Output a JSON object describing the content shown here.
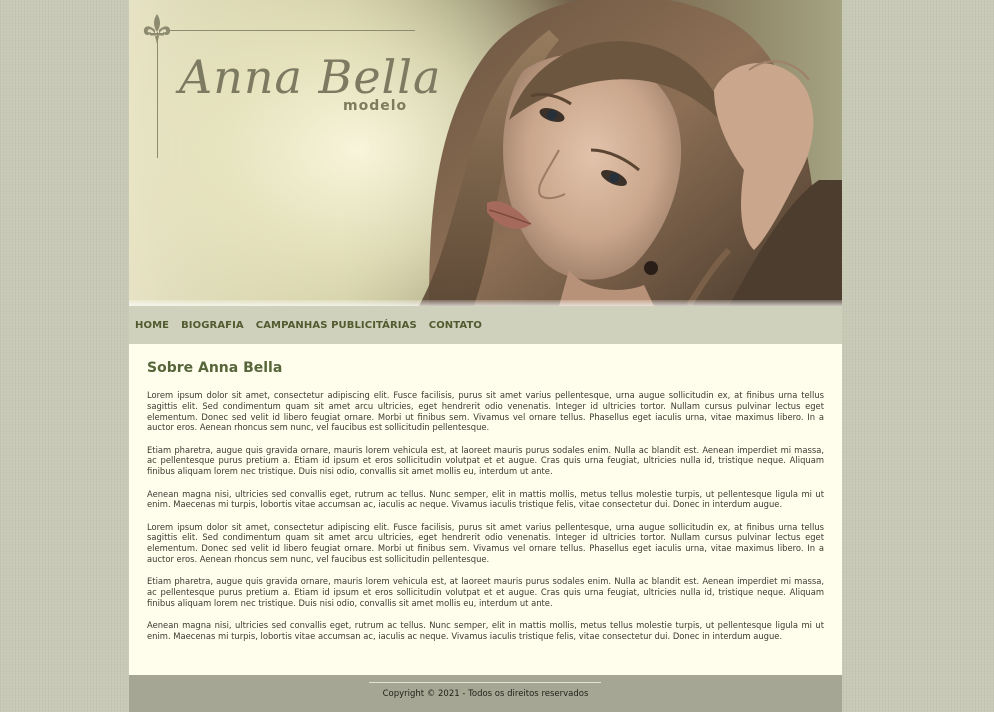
{
  "header": {
    "logo_title": "Anna Bella",
    "logo_subtitle": "modelo"
  },
  "nav": {
    "items": [
      {
        "label": "HOME"
      },
      {
        "label": "BIOGRAFIA"
      },
      {
        "label": "CAMPANHAS PUBLICITÁRIAS"
      },
      {
        "label": "CONTATO"
      }
    ]
  },
  "content": {
    "title": "Sobre Anna Bella",
    "paragraphs": [
      "Lorem ipsum dolor sit amet, consectetur adipiscing elit. Fusce facilisis, purus sit amet varius pellentesque, urna augue sollicitudin ex, at finibus urna tellus sagittis elit. Sed condimentum quam sit amet arcu ultricies, eget hendrerit odio venenatis. Integer id ultricies tortor. Nullam cursus pulvinar lectus eget elementum. Donec sed velit id libero feugiat ornare. Morbi ut finibus sem. Vivamus vel ornare tellus. Phasellus eget iaculis urna, vitae maximus libero. In a auctor eros. Aenean rhoncus sem nunc, vel faucibus est sollicitudin pellentesque.",
      "Etiam pharetra, augue quis gravida ornare, mauris lorem vehicula est, at laoreet mauris purus sodales enim. Nulla ac blandit est. Aenean imperdiet mi massa, ac pellentesque purus pretium a. Etiam id ipsum et eros sollicitudin volutpat et et augue. Cras quis urna feugiat, ultricies nulla id, tristique neque. Aliquam finibus aliquam lorem nec tristique. Duis nisi odio, convallis sit amet mollis eu, interdum ut ante.",
      "Aenean magna nisi, ultricies sed convallis eget, rutrum ac tellus. Nunc semper, elit in mattis mollis, metus tellus molestie turpis, ut pellentesque ligula mi ut enim. Maecenas mi turpis, lobortis vitae accumsan ac, iaculis ac neque. Vivamus iaculis tristique felis, vitae consectetur dui. Donec in interdum augue.",
      "Lorem ipsum dolor sit amet, consectetur adipiscing elit. Fusce facilisis, purus sit amet varius pellentesque, urna augue sollicitudin ex, at finibus urna tellus sagittis elit. Sed condimentum quam sit amet arcu ultricies, eget hendrerit odio venenatis. Integer id ultricies tortor. Nullam cursus pulvinar lectus eget elementum. Donec sed velit id libero feugiat ornare. Morbi ut finibus sem. Vivamus vel ornare tellus. Phasellus eget iaculis urna, vitae maximus libero. In a auctor eros. Aenean rhoncus sem nunc, vel faucibus est sollicitudin pellentesque.",
      "Etiam pharetra, augue quis gravida ornare, mauris lorem vehicula est, at laoreet mauris purus sodales enim. Nulla ac blandit est. Aenean imperdiet mi massa, ac pellentesque purus pretium a. Etiam id ipsum et eros sollicitudin volutpat et et augue. Cras quis urna feugiat, ultricies nulla id, tristique neque. Aliquam finibus aliquam lorem nec tristique. Duis nisi odio, convallis sit amet mollis eu, interdum ut ante.",
      "Aenean magna nisi, ultricies sed convallis eget, rutrum ac tellus. Nunc semper, elit in mattis mollis, metus tellus molestie turpis, ut pellentesque ligula mi ut enim. Maecenas mi turpis, lobortis vitae accumsan ac, iaculis ac neque. Vivamus iaculis tristique felis, vitae consectetur dui. Donec in interdum augue."
    ]
  },
  "footer": {
    "copyright": "Copyright © 2021 - Todos os direitos reservados"
  },
  "colors": {
    "page_background": "#c8cab7",
    "nav_background": "#cfd1bd",
    "nav_text": "#525a2f",
    "content_background": "#fffdec",
    "title_color": "#56663a",
    "footer_background": "#a6a694"
  }
}
